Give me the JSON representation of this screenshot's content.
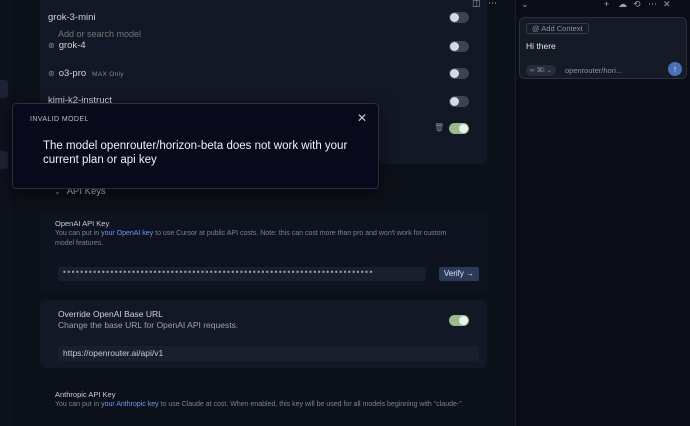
{
  "models": {
    "search_placeholder": "Add or search model",
    "items": [
      {
        "name": "grok-3-mini",
        "badge": "",
        "enabled": false
      },
      {
        "name": "grok-4",
        "badge": "",
        "enabled": false
      },
      {
        "name": "o3-pro",
        "badge": "MAX Only",
        "enabled": false
      },
      {
        "name": "kimi-k2-instruct",
        "badge": "",
        "enabled": false
      }
    ]
  },
  "modal": {
    "title": "INVALID MODEL",
    "message": "The model openrouter/horizon-beta does not work with your current plan or api key"
  },
  "api_keys": {
    "section_title": "API Keys",
    "openai_label": "OpenAI API Key",
    "openai_desc_before": "You can put in ",
    "openai_desc_link": "your OpenAI key",
    "openai_desc_after": " to use Cursor at public API costs. Note: this can cost more than pro and won't work for custom model features.",
    "openai_key_value": "••••••••••••••••••••••••••••••••••••••••••••••••••••••••••••••••••••••••",
    "verify_label": "Verify →",
    "override_title": "Override OpenAI Base URL",
    "override_desc": "Change the base URL for OpenAI API requests.",
    "override_enabled": true,
    "base_url_value": "https://openrouter.ai/api/v1",
    "anthropic_label": "Anthropic API Key",
    "anthropic_desc_before": "You can put in ",
    "anthropic_desc_link": "your Anthropic key",
    "anthropic_desc_after": " to use Claude at cost. When enabled, this key will be used for all models beginning with \"claude-\"."
  },
  "chat": {
    "add_context_label": "Add Context",
    "input_text": "Hi there",
    "mode_label": "∞ ⌘I ⌄",
    "model_label": "openrouter/hori...",
    "send_icon": "arrow-up-icon"
  },
  "colors": {
    "accent": "#6b9cf0",
    "toggle_on": "#9eb98f",
    "modal_bg": "#080a1c"
  }
}
